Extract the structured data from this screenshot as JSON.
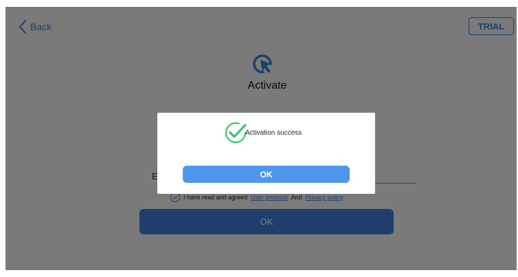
{
  "header": {
    "back_label": "Back",
    "trial_label": "TRIAL"
  },
  "main": {
    "title": "Activate",
    "field_label": "E",
    "agreement": {
      "prefix": "I have read and agreed",
      "user_protocol": "User protocol",
      "and": "And",
      "privacy_policy": "Privacy policy"
    },
    "ok_label": "OK"
  },
  "dialog": {
    "message": "Activation success",
    "ok_label": "OK"
  },
  "colors": {
    "accent": "#3a7fd5",
    "success": "#3cc36b",
    "field_underline": "#2aa84a"
  },
  "icons": {
    "back": "chevron-left-icon",
    "logo": "cursor-click-icon",
    "success": "check-circle-icon",
    "agree": "check-circle-icon"
  }
}
